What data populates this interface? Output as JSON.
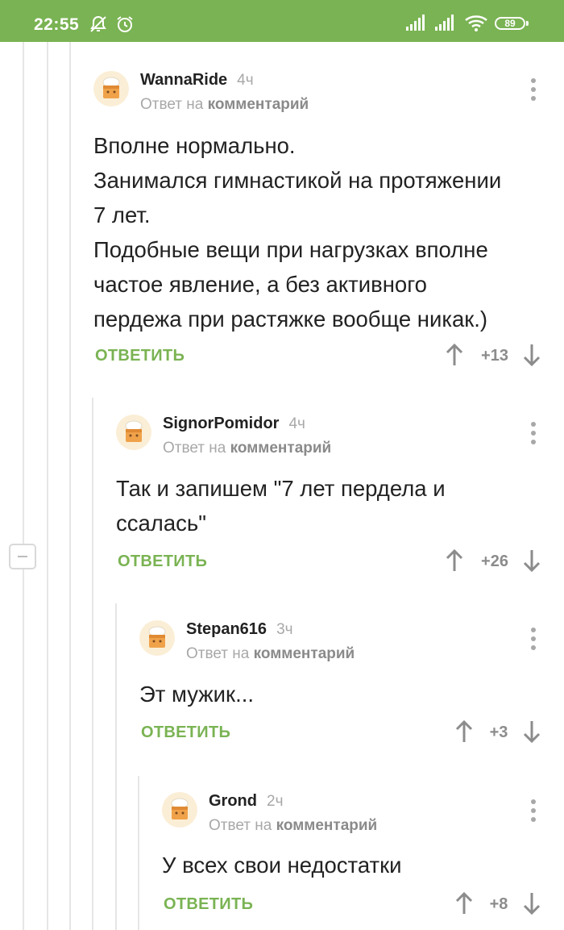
{
  "status_bar": {
    "time": "22:55",
    "battery": "89",
    "icons": [
      "notifications-off-icon",
      "alarm-icon",
      "signal-icon",
      "signal-icon",
      "wifi-icon",
      "battery-icon"
    ]
  },
  "ui": {
    "reply_to_prefix": "Ответ на",
    "reply_to_target": "комментарий",
    "reply_label": "ОТВЕТИТЬ"
  },
  "comments": [
    {
      "author": "WannaRide",
      "time": "4ч",
      "lines": [
        "Вполне нормально.",
        "Занимался гимнастикой на протяжении",
        "7 лет.",
        "Подобные вещи при нагрузках вполне",
        "частое явление,  а без активного",
        "пердежа при растяжке вообще никак.)"
      ],
      "score": "+13"
    },
    {
      "author": "SignorPomidor",
      "time": "4ч",
      "lines": [
        "Так и запишем \"7 лет пердела и",
        "ссалась\""
      ],
      "score": "+26"
    },
    {
      "author": "Stepan616",
      "time": "3ч",
      "lines": [
        "Эт мужик..."
      ],
      "score": "+3"
    },
    {
      "author": "Grond",
      "time": "2ч",
      "lines": [
        "У всех свои недостатки"
      ],
      "score": "+8"
    }
  ],
  "colors": {
    "accent": "#7ab353",
    "muted": "#a8a8a8",
    "text": "#222222"
  }
}
